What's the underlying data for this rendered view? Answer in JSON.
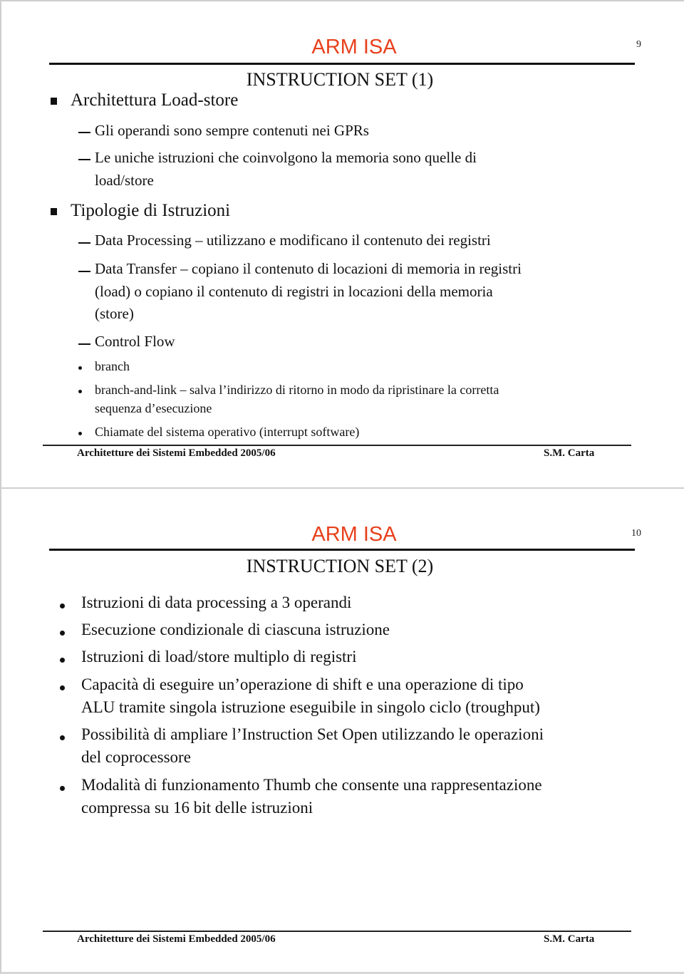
{
  "slides": [
    {
      "number": "9",
      "title": "ARM ISA",
      "subtitle": "INSTRUCTION SET (1)",
      "sections": [
        {
          "heading": "Architettura Load-store",
          "items": [
            {
              "text": "Gli operandi sono sempre contenuti nei GPRs"
            },
            {
              "text": "Le uniche istruzioni che coinvolgono la memoria sono quelle di",
              "cont": "load/store"
            }
          ]
        },
        {
          "heading": "Tipologie di Istruzioni",
          "items": [
            {
              "text": "Data Processing – utilizzano e modificano il contenuto dei registri"
            },
            {
              "text": "Data Transfer – copiano il contenuto di locazioni di  memoria in registri",
              "cont": "(load) o copiano il contenuto di registri in locazioni della  memoria",
              "cont2": "(store)"
            },
            {
              "text": "Control Flow",
              "subitems": [
                {
                  "text": "branch"
                },
                {
                  "text": "branch-and-link –  salva l’indirizzo di ritorno in modo da ripristinare la corretta",
                  "cont": "sequenza d’esecuzione"
                },
                {
                  "text": "Chiamate del sistema operativo (interrupt software)"
                }
              ]
            }
          ]
        }
      ],
      "footer": {
        "left": "Architetture dei Sistemi Embedded 2005/06",
        "right": "S.M. Carta"
      }
    },
    {
      "number": "10",
      "title": "ARM ISA",
      "subtitle": "INSTRUCTION SET (2)",
      "bullets": [
        {
          "text": "Istruzioni di data processing a 3 operandi"
        },
        {
          "text": "Esecuzione condizionale di ciascuna istruzione"
        },
        {
          "text": "Istruzioni di load/store multiplo di registri"
        },
        {
          "text": "Capacità di eseguire un’operazione di shift e una operazione di tipo",
          "cont": "ALU tramite singola istruzione eseguibile in singolo ciclo (troughput)"
        },
        {
          "text": "Possibilità di ampliare l’Instruction Set Open utilizzando le operazioni",
          "cont": "del coprocessore"
        },
        {
          "text": "Modalità di funzionamento Thumb che consente una rappresentazione",
          "cont": "compressa su 16 bit delle istruzioni"
        }
      ],
      "footer": {
        "left": "Architetture dei Sistemi Embedded 2005/06",
        "right": "S.M. Carta"
      }
    }
  ],
  "colors": {
    "title": "#e8401c",
    "text": "#111111",
    "page_border": "#cfcfcf"
  }
}
